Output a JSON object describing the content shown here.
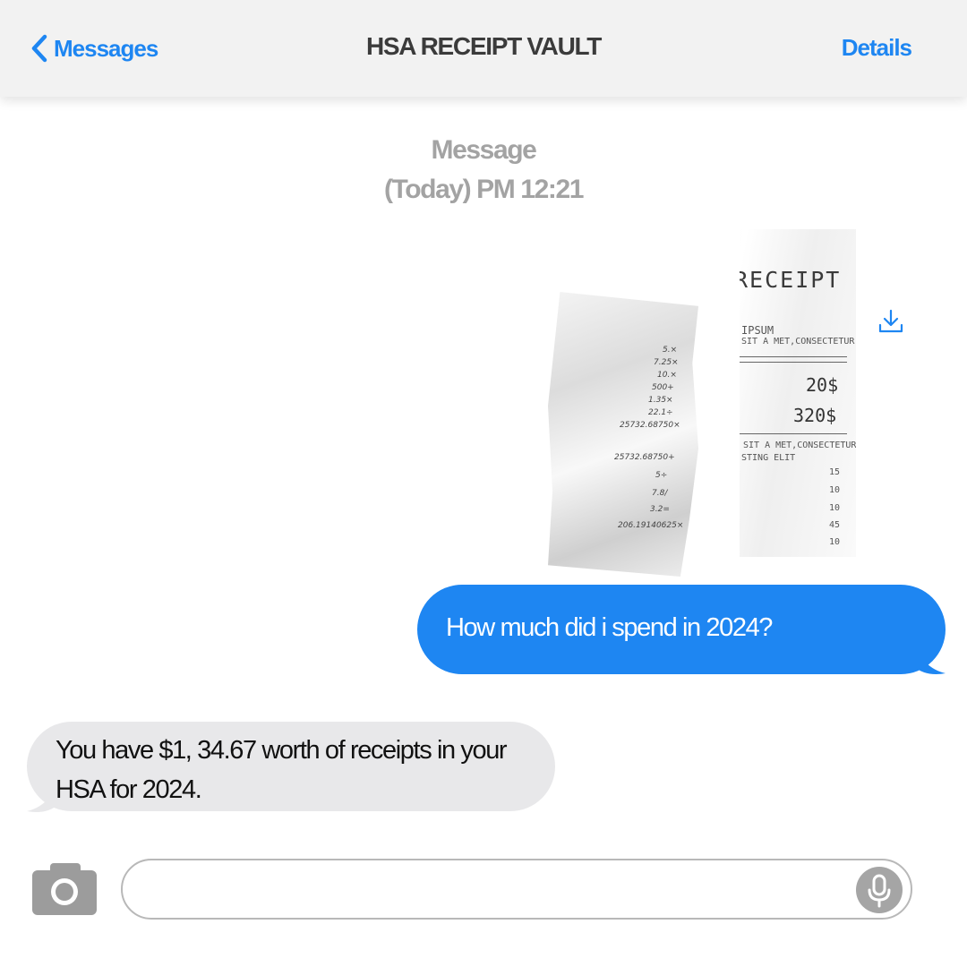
{
  "header": {
    "back_label": "Messages",
    "title": "HSA RECEIPT VAULT",
    "details_label": "Details"
  },
  "timestamp": {
    "line1": "Message",
    "line2": "(Today) PM 12:21"
  },
  "attachment": {
    "back_receipt": {
      "heading": "RECEIPT",
      "line1": "IPSUM",
      "line2": "SIT A MET,CONSECTETUR",
      "price1": "20$",
      "price2": "320$",
      "line3": "SIT A MET,CONSECTETUR",
      "line4": "STING ELIT",
      "numbers": [
        "15",
        "10",
        "10",
        "45",
        "10"
      ]
    },
    "front_receipt": {
      "values": [
        "5.×",
        "7.25×",
        "10.×",
        "500+",
        "1.35×",
        "22.1÷",
        "25732.68750×",
        "25732.68750+",
        "5÷",
        "7.8/",
        "3.2=",
        "206.19140625×"
      ]
    },
    "download_icon": "download-icon"
  },
  "messages": {
    "outgoing": "How much did i spend in 2024?",
    "incoming": "You have $1, 34.67 worth of receipts in your HSA for 2024."
  },
  "composer": {
    "placeholder": "",
    "camera_icon": "camera-icon",
    "mic_icon": "microphone-icon"
  },
  "colors": {
    "accent": "#1e86f2",
    "incoming_bubble": "#e8e8ea",
    "header_bg": "#f2f2f2",
    "muted_text": "#a3a3a3"
  }
}
